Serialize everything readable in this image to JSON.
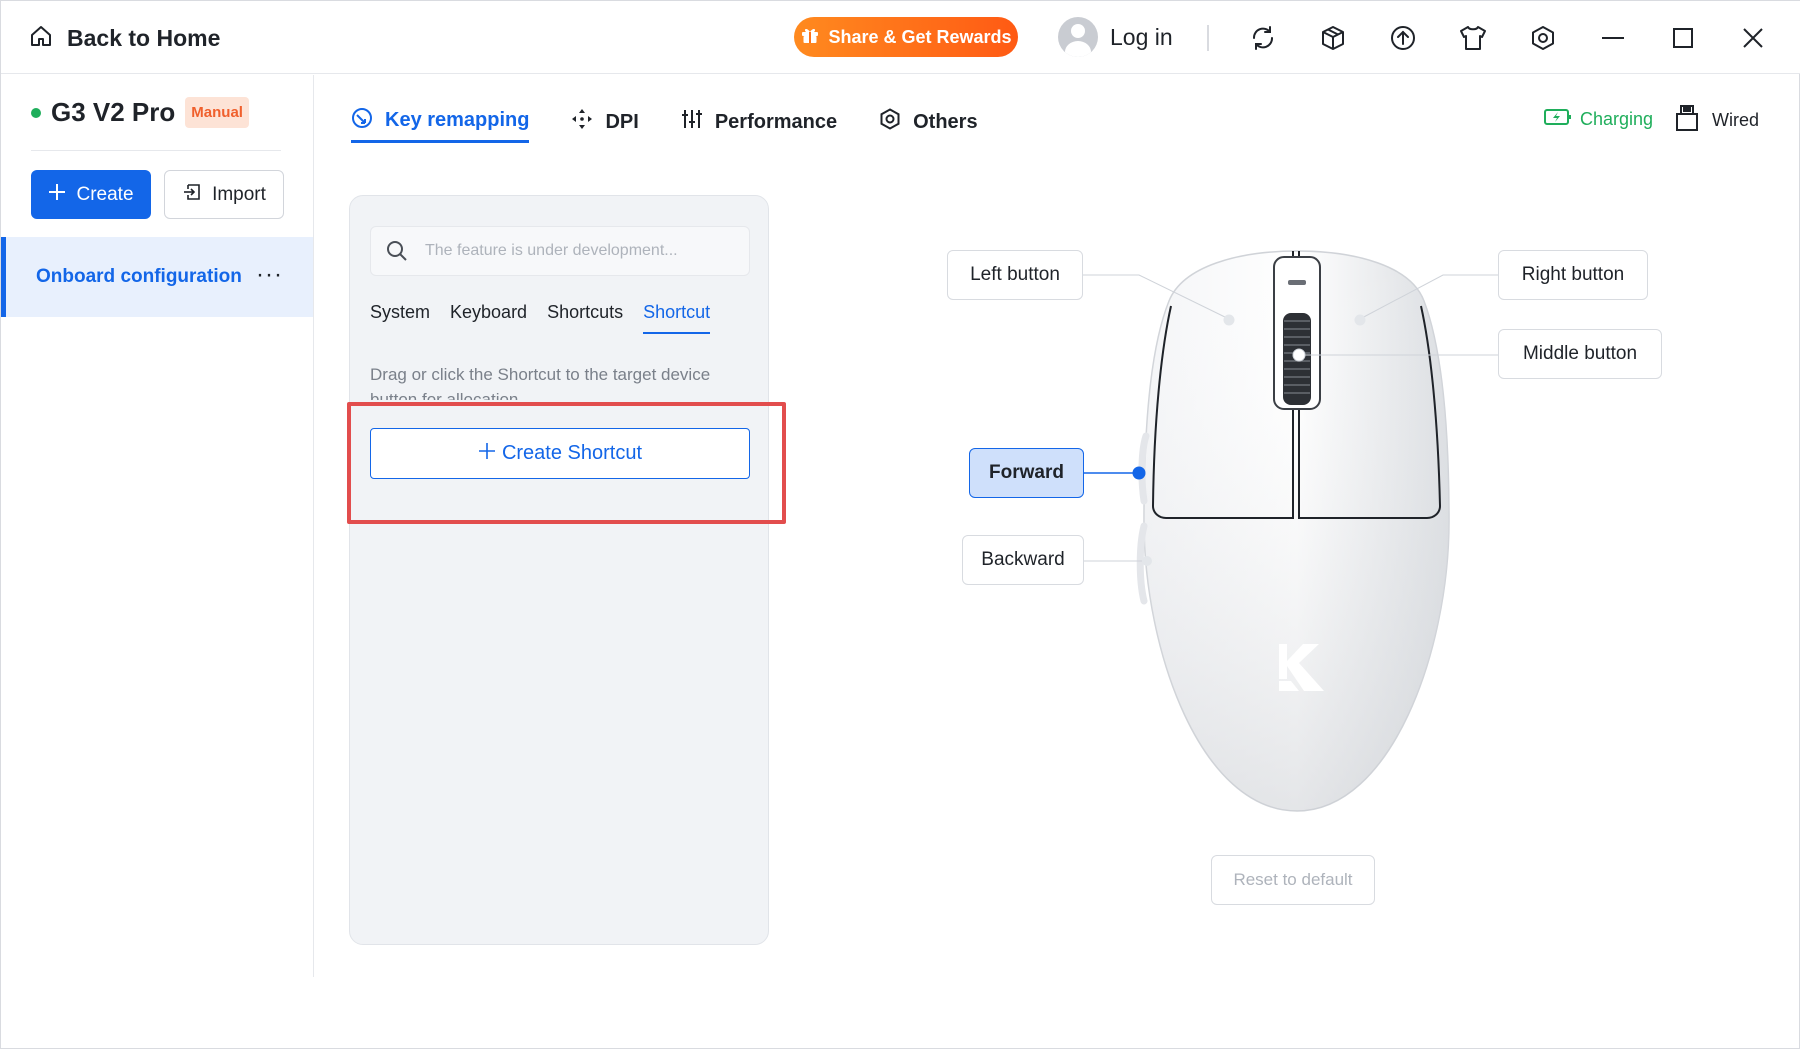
{
  "titlebar": {
    "back_label": "Back to Home",
    "share_label": "Share & Get Rewards",
    "login_label": "Log in"
  },
  "sidebar": {
    "device_name": "G3 V2 Pro",
    "badge": "Manual",
    "create_label": "Create",
    "import_label": "Import",
    "config_label": "Onboard configuration",
    "more_label": "···"
  },
  "tabs": [
    {
      "label": "Key remapping",
      "icon": "key-remap-icon",
      "active": true
    },
    {
      "label": "DPI",
      "icon": "dpi-icon",
      "active": false
    },
    {
      "label": "Performance",
      "icon": "sliders-icon",
      "active": false
    },
    {
      "label": "Others",
      "icon": "hexagon-gear-icon",
      "active": false
    }
  ],
  "status": {
    "charging_label": "Charging",
    "wired_label": "Wired"
  },
  "panel": {
    "search_placeholder": "The feature is under development...",
    "subtabs": [
      "System",
      "Keyboard",
      "Shortcuts",
      "Shortcut"
    ],
    "active_subtab": "Shortcut",
    "hint": "Drag or click the Shortcut to the target device button for allocation",
    "create_shortcut_label": "Create Shortcut"
  },
  "mouse": {
    "left_button": "Left button",
    "right_button": "Right button",
    "middle_button": "Middle button",
    "forward": "Forward",
    "backward": "Backward",
    "active_button": "Forward",
    "reset_label": "Reset to default"
  },
  "colors": {
    "accent": "#1366e8",
    "success": "#1fae5b",
    "share_gradient_start": "#ff8a1f",
    "share_gradient_end": "#ff5a14",
    "highlight": "#e24d4d",
    "badge_text": "#f0602d"
  }
}
